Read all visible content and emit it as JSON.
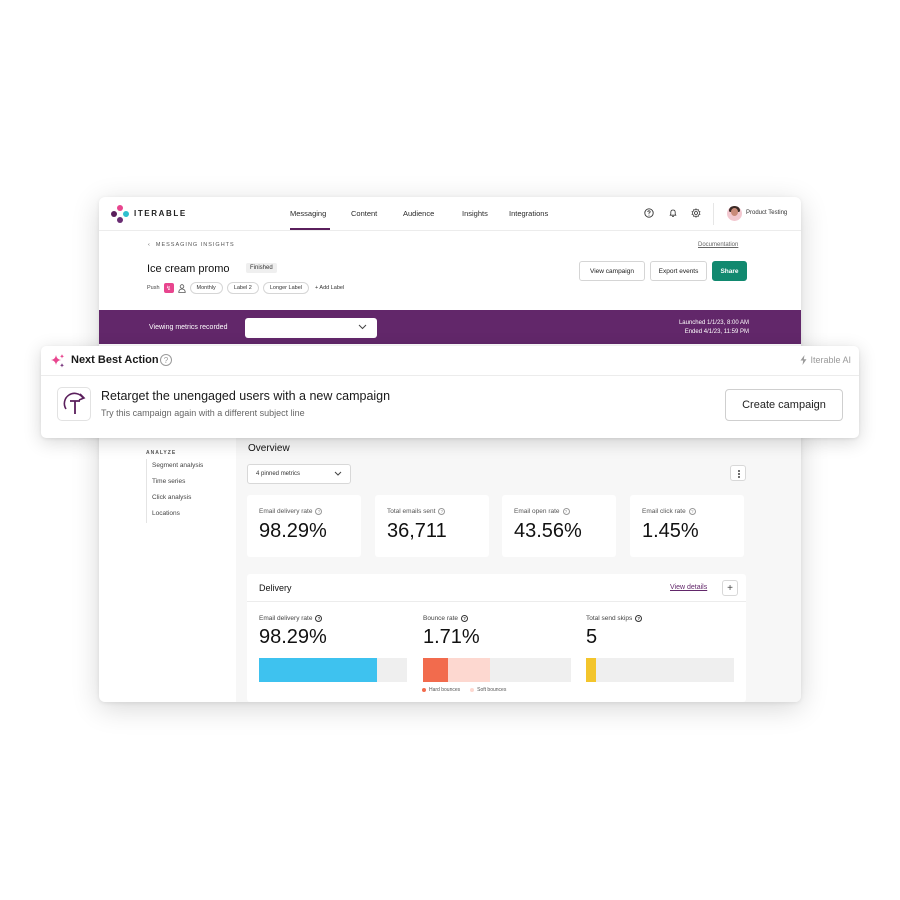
{
  "app": {
    "brand": "ITERABLE",
    "nav": [
      "Messaging",
      "Content",
      "Audience",
      "Insights",
      "Integrations"
    ],
    "active_nav": "Messaging",
    "user_name": "Product Testing"
  },
  "header": {
    "breadcrumb": "MESSAGING INSIGHTS",
    "documentation": "Documentation",
    "title": "Ice cream promo",
    "status": "Finished",
    "buttons": {
      "view_campaign": "View campaign",
      "export_events": "Export events",
      "share": "Share"
    },
    "channel": "Push",
    "labels": [
      "Monthly",
      "Label 2",
      "Longer Label"
    ],
    "add_label": "+ Add Label"
  },
  "metrics_bar": {
    "viewing_label": "Viewing metrics recorded",
    "select_value": "",
    "launched": "Launched 1/1/23, 8:00 AM",
    "ended": "Ended 4/1/23, 11:59 PM"
  },
  "next_best_action": {
    "title": "Next Best Action",
    "ai_tag": "Iterable AI",
    "headline": "Retarget the unengaged users with a new campaign",
    "subtext": "Try this campaign again with a different subject line",
    "button": "Create campaign"
  },
  "sidebar": {
    "heading": "ANALYZE",
    "items": [
      "Segment analysis",
      "Time series",
      "Click analysis",
      "Locations"
    ]
  },
  "overview": {
    "title": "Overview",
    "pinned": "4 pinned metrics",
    "kpis": [
      {
        "label": "Email delivery rate",
        "value": "98.29%"
      },
      {
        "label": "Total emails sent",
        "value": "36,711"
      },
      {
        "label": "Email open rate",
        "value": "43.56%"
      },
      {
        "label": "Email click rate",
        "value": "1.45%"
      }
    ]
  },
  "delivery": {
    "title": "Delivery",
    "view_details": "View details",
    "metrics": [
      {
        "label": "Email delivery rate",
        "value": "98.29%",
        "fill": 0.8,
        "color": "#3ec2ef"
      },
      {
        "label": "Bounce rate",
        "value": "1.71%"
      },
      {
        "label": "Total send skips",
        "value": "5",
        "fill": 0.07,
        "color": "#f3c52c"
      }
    ],
    "bounce_segments": {
      "hard": 0.17,
      "soft": 0.45,
      "hard_color": "#f26b4d",
      "soft_color": "#fdd8d0"
    },
    "legend": [
      "Hard bounces",
      "Soft bounces"
    ]
  },
  "colors": {
    "brand_purple": "#62276a",
    "share_green": "#11896f",
    "push_pink": "#e8458e"
  }
}
